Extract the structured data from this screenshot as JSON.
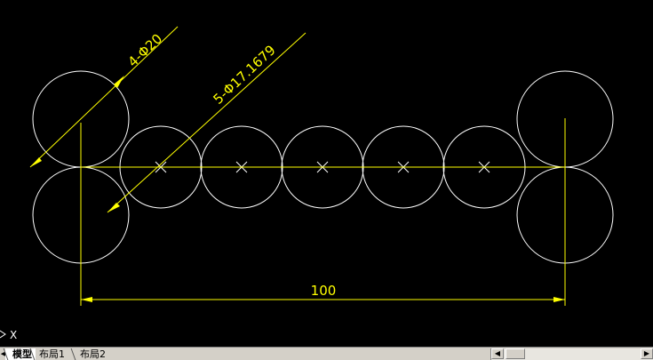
{
  "drawing": {
    "dimensions": {
      "diameter_four": "4-Φ20",
      "diameter_five": "5-Φ17.1679",
      "linear_length": "100"
    },
    "crosshair_label": "X",
    "colors": {
      "background": "#000000",
      "geometry": "#ffffff",
      "dimension": "#ffff00"
    }
  },
  "layout_tabs": {
    "tabs": [
      "模型",
      "布局1",
      "布局2"
    ],
    "active": "模型"
  },
  "icons": {
    "ucs": "ucs-icon",
    "scroll_left": "arrow-left-icon",
    "scroll_right": "arrow-right-icon"
  }
}
